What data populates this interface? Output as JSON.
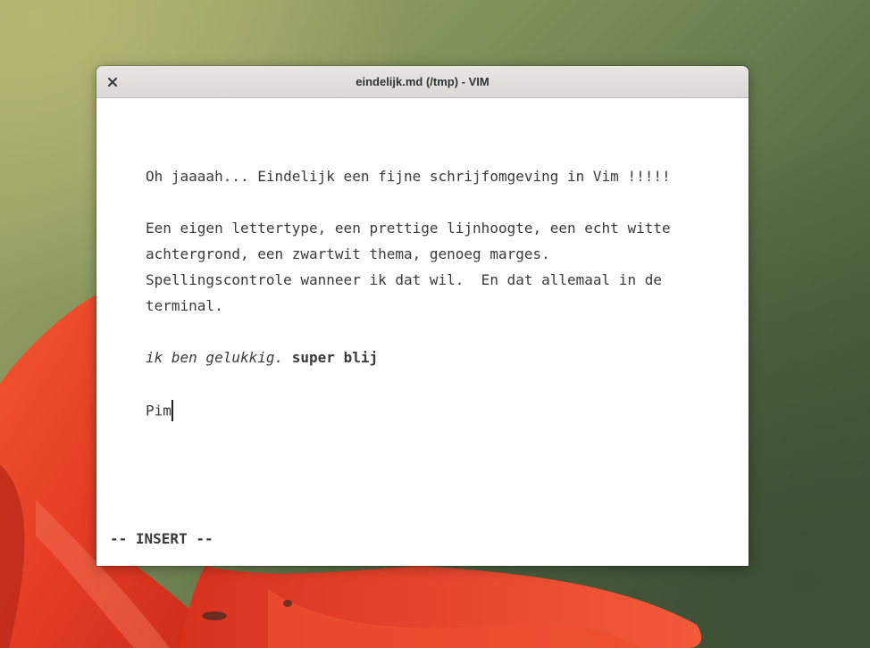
{
  "window": {
    "title": "eindelijk.md (/tmp) - VIM"
  },
  "editor": {
    "line1": "Oh jaaaah... Eindelijk een fijne schrijfomgeving in Vim !!!!!",
    "line2": "Een eigen lettertype, een prettige lijnhoogte, een echt witte",
    "line3": "achtergrond, een zwartwit thema, genoeg marges.",
    "line4": "Spellingscontrole wanneer ik dat wil.  En dat allemaal in de",
    "line5": "terminal.",
    "line6_italic": "ik ben gelukkig.",
    "line6_bold": "super blij",
    "line7": "Pim"
  },
  "statusline": {
    "mode": "-- INSERT --"
  },
  "icons": {
    "close": "close-icon"
  },
  "colors": {
    "titlebar": "#dcd9d5",
    "editor_bg": "#ffffff",
    "text": "#3a3a3a",
    "petal": "#e8412a"
  }
}
